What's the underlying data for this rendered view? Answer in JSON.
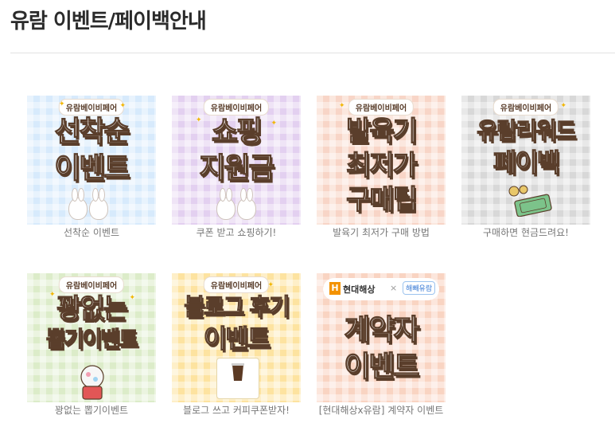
{
  "page": {
    "title": "유람 이벤트/페이백안내"
  },
  "events": [
    {
      "badge": "유람베이비페어",
      "lines": [
        "선착순",
        "이벤트"
      ],
      "caption": "선착순 이벤트",
      "bg": "#d7eafc"
    },
    {
      "badge": "유람베이비페어",
      "lines": [
        "쇼핑",
        "지원금"
      ],
      "caption": "쿠폰 받고 쇼핑하기!",
      "bg": "#e3d0f0"
    },
    {
      "badge": "유람베이비페어",
      "lines": [
        "발육기",
        "최저가",
        "구매팁"
      ],
      "caption": "발육기 최저가 구매 방법",
      "bg": "#f8d5c7"
    },
    {
      "badge": "유람베이비페어",
      "lines": [
        "유람리워드",
        "페이백"
      ],
      "caption": "구매하면 현금드려요!",
      "bg": "#d8d8d8"
    },
    {
      "badge": "유람베이비페어",
      "lines": [
        "꽝없는",
        "뽑기이벤트"
      ],
      "caption": "꽝없는 뽑기이벤트",
      "bg": "#dcecc9"
    },
    {
      "badge": "유람베이비페어",
      "lines": [
        "블로그 후기",
        "이벤트"
      ],
      "caption": "블로그 쓰고 커피쿠폰받자!",
      "bg": "#fde3a0"
    },
    {
      "badge": "현대해상",
      "badge2": "해빼유람",
      "lines": [
        "계약자",
        "이벤트"
      ],
      "caption": "[현대해상x유람] 계약자 이벤트",
      "bg": "#f9d4c2"
    }
  ]
}
